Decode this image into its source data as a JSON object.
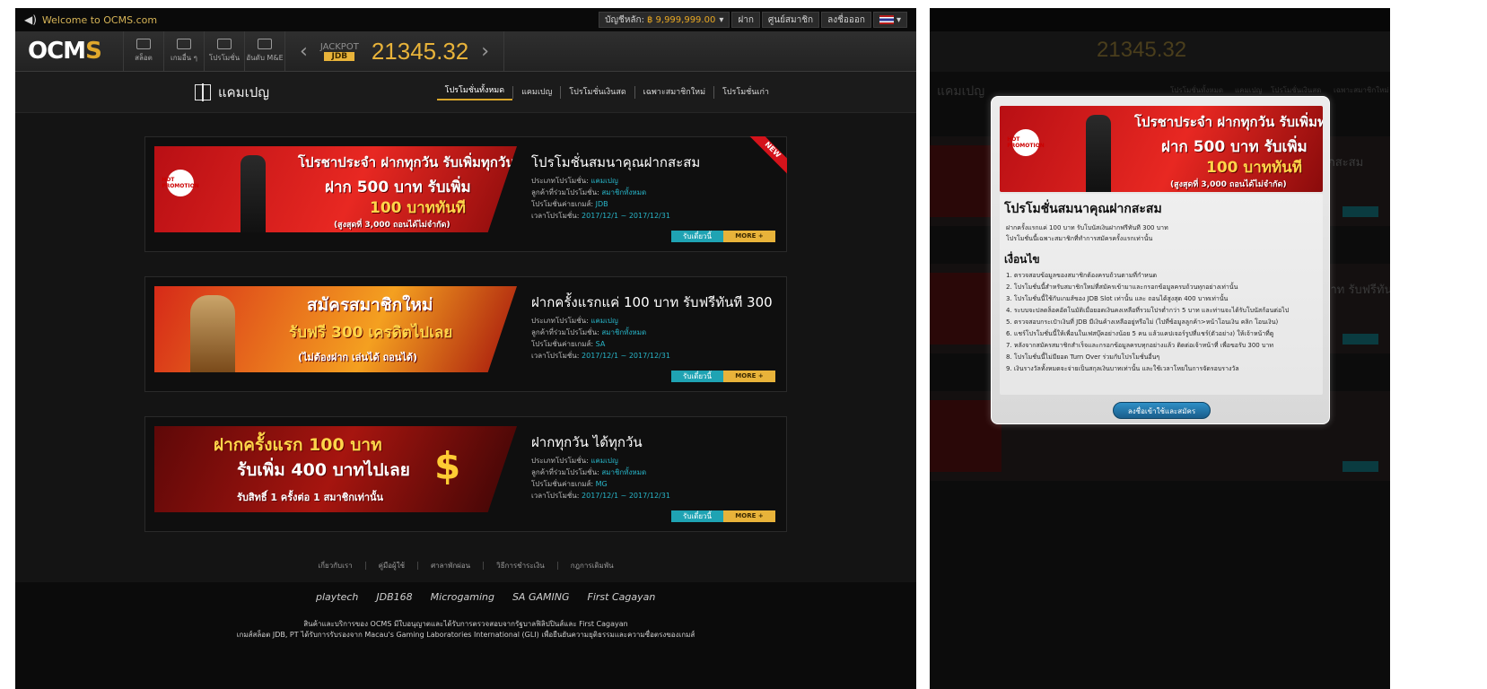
{
  "topbar": {
    "welcome": "Welcome to OCMS.com",
    "balance_label": "บัญชีหลัก:",
    "balance_value": "฿ 9,999,999.00",
    "deposit": "ฝาก",
    "member_center": "ศูนย์สมาชิก",
    "logout": "ลงชื่อออก"
  },
  "header": {
    "logo": "OCMS",
    "nav": [
      {
        "label": "สล็อต"
      },
      {
        "label": "เกมอื่น ๆ"
      },
      {
        "label": "โปรโมชั่น"
      },
      {
        "label": "อันดับ M&E"
      }
    ],
    "jackpot_label": "JACKPOT",
    "jackpot_provider": "JDB",
    "jackpot_value": "21345.32"
  },
  "page": {
    "title": "แคมเปญ",
    "tabs": [
      "โปรโมชั่นทั้งหมด",
      "แคมเปญ",
      "โปรโมชั่นเงินสด",
      "เฉพาะสมาชิกใหม่",
      "โปรโมชั่นเก่า"
    ]
  },
  "meta_labels": {
    "type": "ประเภทโปรโมชั่น:",
    "customer": "ลูกค้าที่ร่วมโปรโมชั่น:",
    "provider": "โปรโมชั่นค่ายเกมส์:",
    "period": "เวลาโปรโมชั่น:"
  },
  "promos": [
    {
      "title": "โปรโมชั่นสมนาคุณฝากสะสม",
      "type": "แคมเปญ",
      "customer": "สมาชิกทั้งหมด",
      "provider": "JDB",
      "period": "2017/12/1 ~ 2017/12/31",
      "badge": "NEW",
      "banner": {
        "line1": "โปรชาประจำ ฝากทุกวัน รับเพิ่มทุกวัน",
        "line2": "ฝาก 500 บาท รับเพิ่ม",
        "line3": "100 บาททันที",
        "line4": "(สูงสุดที่ 3,000 ถอนได้ไม่จำกัด)",
        "hot": "HOT PROMOTION"
      }
    },
    {
      "title": "ฝากครั้งแรกแค่ 100 บาท รับฟรีทันที 300",
      "type": "แคมเปญ",
      "customer": "สมาชิกทั้งหมด",
      "provider": "SA",
      "period": "2017/12/1 ~ 2017/12/31",
      "banner": {
        "line1": "สมัครสมาชิกใหม่",
        "line2": "รับฟรี 300 เครดิตไปเลย",
        "line3": "(ไม่ต้องฝาก เล่นได้ ถอนได้)"
      }
    },
    {
      "title": "ฝากทุกวัน ได้ทุกวัน",
      "type": "แคมเปญ",
      "customer": "สมาชิกทั้งหมด",
      "provider": "MG",
      "period": "2017/12/1 ~ 2017/12/31",
      "banner": {
        "line1": "ฝากครั้งแรก 100 บาท",
        "line2": "รับเพิ่ม 400 บาทไปเลย",
        "line3": "รับสิทธิ์ 1 ครั้งต่อ 1 สมาชิกเท่านั้น"
      }
    }
  ],
  "buttons": {
    "join": "รับเดี๋ยวนี้",
    "more": "MORE +"
  },
  "footer": {
    "links": [
      "เกี่ยวกับเรา",
      "คู่มือผู้ใช้",
      "ศาลาพักผ่อน",
      "วิธีการชำระเงิน",
      "กฎการเดิมพัน"
    ],
    "partners": [
      "playtech",
      "JDB168",
      "Microgaming",
      "SA GAMING",
      "First Cagayan"
    ],
    "disclaimer1": "สินค้าและบริการของ OCMS มีใบอนุญาตและได้รับการตรวจสอบจากรัฐบาลฟิลิปปินส์และ First Cagayan",
    "disclaimer2": "เกมส์สล็อต JDB, PT ได้รับการรับรองจาก Macau's Gaming Laboratories International (GLI) เพื่อยืนยันความยุติธรรมและความซื่อตรงของเกมส์"
  },
  "modal": {
    "title": "โปรโมชั่นสมนาคุณฝากสะสม",
    "intro1": "ฝากครั้งแรกแค่ 100 บาท รับโบนัสเงินฝากฟรีทันที 300 บาท",
    "intro2": "โปรโมชั่นนี้เฉพาะสมาชิกที่ทำการสมัครครั้งแรกเท่านั้น",
    "conditions_title": "เงื่อนไข",
    "conditions": [
      "1. ตรวจสอบข้อมูลของสมาชิกต้องครบถ้วนตามที่กำหนด",
      "2. โปรโมชั่นนี้สำหรับสมาชิกใหม่ที่สมัครเข้ามาและกรอกข้อมูลครบถ้วนทุกอย่างเท่านั้น",
      "3. โปรโมชั่นนี้ใช้กับเกมส์ของ JDB Slot เท่านั้น และ ถอนได้สูงสุด 400 บาทเท่านั้น",
      "4. ระบบจะปลดล็อคอัตโนมัติเมื่อยอดเงินคงเหลือที่รวมโปรต่ำกว่า 5 บาท และท่านจะได้รับโบนัสก้อนต่อไป",
      "5. ตรวจสอบกระเป๋าเงินที่ JDB มีเงินค้างเหลืออยู่หรือไม่ (ไปที่ข้อมูลลูกค้า>หน้าโอนเงิน คลิก โอนเงิน)",
      "6. แชร์โปรโมชั่นนี้ให้เพื่อนในเฟสบุ๊คอย่างน้อย 5 คน แล้วแคปเจอร์รูปที่แชร์(ตัวอย่าง) ให้เจ้าหน้าที่ดู",
      "7. หลังจากสมัครสมาชิกสำเร็จและกรอกข้อมูลครบทุกอย่างแล้ว ติดต่อเจ้าหน้าที่ เพื่อขอรับ 300 บาท",
      "8. โปรโมชั่นนี้ไม่มียอด Turn Over ร่วมกับโปรโมชั่นอื่นๆ",
      "9. เงินรางวัลทั้งหมดจะจ่ายเป็นสกุลเงินบาทเท่านั้น และใช้เวลาโหยในการจัดรอบรางวัล"
    ],
    "button": "ลงชื่อเข้าใช้และสมัคร"
  },
  "colors": {
    "gold": "#e8b33a",
    "teal": "#1fa3b3",
    "background": "#141414"
  }
}
